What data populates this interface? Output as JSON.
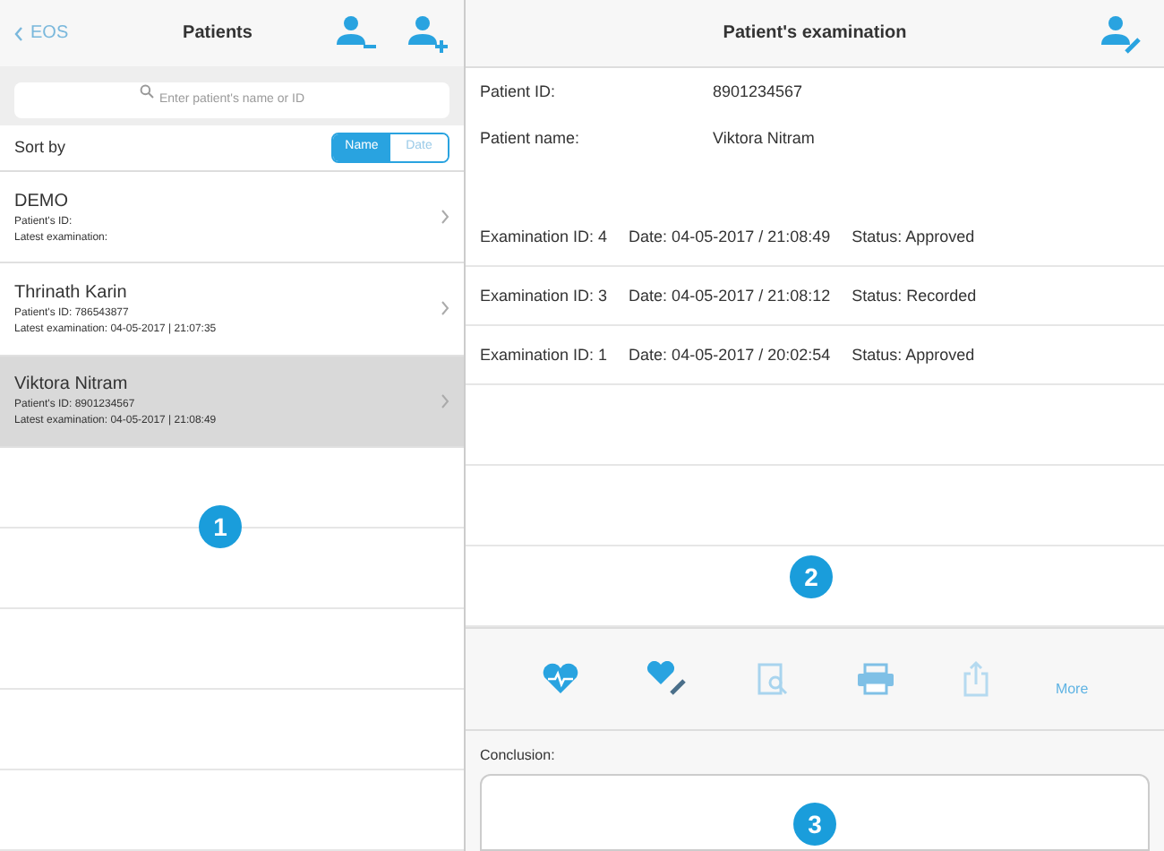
{
  "left_header": {
    "back": "EOS",
    "title": "Patients"
  },
  "search": {
    "placeholder": "Enter patient's name or ID"
  },
  "sort": {
    "label": "Sort by",
    "options": [
      {
        "label": "Name",
        "selected": true
      },
      {
        "label": "Date",
        "selected": false
      }
    ]
  },
  "patients": [
    {
      "name": "DEMO",
      "id_line": "Patient's ID:",
      "exam_line": "Latest examination:",
      "selected": false
    },
    {
      "name": "Thrinath Karin",
      "id_line": "Patient's ID: 786543877",
      "exam_line": "Latest examination: 04-05-2017 | 21:07:35",
      "selected": false
    },
    {
      "name": "Viktora Nitram",
      "id_line": "Patient's ID: 8901234567",
      "exam_line": "Latest examination: 04-05-2017 | 21:08:49",
      "selected": true
    }
  ],
  "right_header": {
    "title": "Patient's examination"
  },
  "patient_fields": [
    {
      "label": "Patient ID:",
      "value": "8901234567"
    },
    {
      "label": "Patient name:",
      "value": "Viktora Nitram"
    }
  ],
  "examinations": [
    {
      "id": "Examination ID: 4",
      "date": "Date: 04-05-2017 / 21:08:49",
      "status": "Status: Approved"
    },
    {
      "id": "Examination ID: 3",
      "date": "Date: 04-05-2017 / 21:08:12",
      "status": "Status: Recorded"
    },
    {
      "id": "Examination ID: 1",
      "date": "Date: 04-05-2017 / 20:02:54",
      "status": "Status: Approved"
    }
  ],
  "toolbar": {
    "more": "More"
  },
  "conclusion": {
    "label": "Conclusion:"
  },
  "callouts": [
    "1",
    "2",
    "3"
  ]
}
